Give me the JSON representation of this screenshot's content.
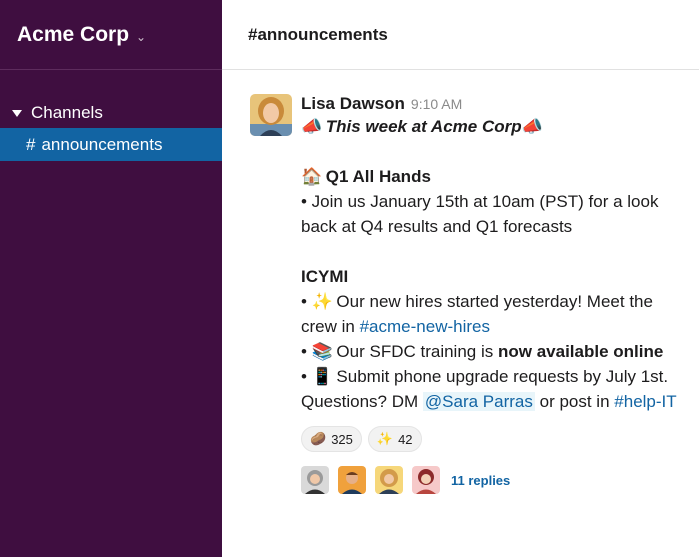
{
  "workspace": {
    "name": "Acme Corp",
    "caret_icon": "chevron-down-icon"
  },
  "sidebar": {
    "section_label": "Channels",
    "channels": [
      {
        "hash": "#",
        "name": "announcements",
        "active": true
      }
    ]
  },
  "header": {
    "channel_title": "#announcements"
  },
  "message": {
    "sender": "Lisa Dawson",
    "time": "9:10 AM",
    "lines": {
      "l1_emoji_a": "📣",
      "l1_text": "This week at Acme Corp",
      "l1_emoji_b": "📣",
      "l2_emoji": "🏠",
      "l2_text": "Q1 All Hands",
      "l3_text": "• Join us January 15th at 10am (PST) for a look",
      "l4_text": "back at Q4 results and Q1 forecasts",
      "l5_text": "ICYMI",
      "l6_bullet": "•",
      "l6_emoji": "✨",
      "l6_text": "Our new hires started yesterday! Meet the",
      "l7_text": "crew in",
      "l7_link": "#acme-new-hires",
      "l8_bullet": "•",
      "l8_emoji": "📚",
      "l8_text": "Our SFDC training is",
      "l8_bold": "now available online",
      "l9_bullet": "•",
      "l9_emoji": "📱",
      "l9_text": "Submit phone upgrade requests by July 1st.",
      "l10_text_a": "Questions? DM",
      "l10_mention": "@Sara Parras",
      "l10_text_b": "or post in",
      "l10_link": "#help-IT"
    },
    "reactions": [
      {
        "emoji": "🥔",
        "count": "325"
      },
      {
        "emoji": "✨",
        "count": "42"
      }
    ],
    "thread": {
      "replies": "11 replies"
    }
  },
  "colors": {
    "sidebar_bg": "#3f0e40",
    "active_channel": "#1264a3",
    "link": "#1264a3"
  }
}
